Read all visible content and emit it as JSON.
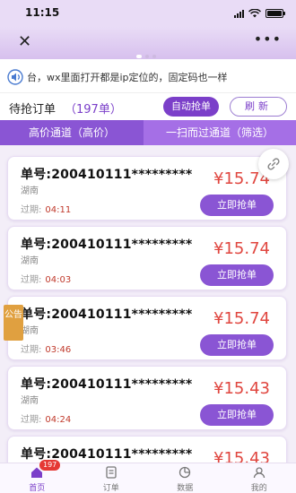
{
  "status": {
    "time": "11:15"
  },
  "notice": {
    "text": "台，wx里面打开都是ip定位的，固定码也一样"
  },
  "toolbar": {
    "title": "待抢订单",
    "count": "（197单）",
    "auto_label": "自动抢单",
    "refresh_label": "刷新"
  },
  "tabs": [
    {
      "label": "高价通道（高价）"
    },
    {
      "label": "一扫而过通道（筛选）"
    }
  ],
  "orders": [
    {
      "no": "单号:200410111*********",
      "region": "湖南",
      "expire_label": "过期:",
      "expire": "04:11",
      "price": "¥15.74",
      "action": "立即抢单"
    },
    {
      "no": "单号:200410111*********",
      "region": "湖南",
      "expire_label": "过期:",
      "expire": "04:03",
      "price": "¥15.74",
      "action": "立即抢单"
    },
    {
      "no": "单号:200410111*********",
      "region": "湖南",
      "expire_label": "过期:",
      "expire": "03:46",
      "price": "¥15.74",
      "action": "立即抢单"
    },
    {
      "no": "单号:200410111*********",
      "region": "湖南",
      "expire_label": "过期:",
      "expire": "04:24",
      "price": "¥15.43",
      "action": "立即抢单"
    },
    {
      "no": "单号:200410111*********",
      "region": "",
      "expire_label": "",
      "expire": "",
      "price": "¥15.43",
      "action": ""
    }
  ],
  "announce": {
    "label": "公告"
  },
  "nav": {
    "badge": "197",
    "items": [
      {
        "label": "首页",
        "icon": "home-icon"
      },
      {
        "label": "订单",
        "icon": "order-icon"
      },
      {
        "label": "数据",
        "icon": "chart-icon"
      },
      {
        "label": "我的",
        "icon": "user-icon"
      }
    ]
  },
  "colors": {
    "accent": "#7b3fc9",
    "price": "#e0463f",
    "tab_active": "#8a55d4",
    "tab_inactive": "#a56fe6",
    "badge": "#e53935"
  }
}
